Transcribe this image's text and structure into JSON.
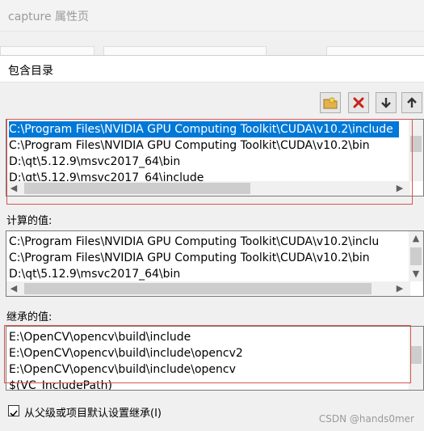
{
  "parent_window": {
    "title": "capture 属性页"
  },
  "dialog": {
    "title": "包含目录"
  },
  "toolbar": {
    "buttons": [
      {
        "icon": "new-folder-icon"
      },
      {
        "icon": "delete-icon"
      },
      {
        "icon": "move-down-icon"
      },
      {
        "icon": "move-up-icon"
      }
    ]
  },
  "include_list": {
    "items": [
      "C:\\Program Files\\NVIDIA GPU Computing Toolkit\\CUDA\\v10.2\\include",
      "C:\\Program Files\\NVIDIA GPU Computing Toolkit\\CUDA\\v10.2\\bin",
      "D:\\qt\\5.12.9\\msvc2017_64\\bin",
      "D:\\qt\\5.12.9\\msvc2017_64\\include"
    ],
    "selected_index": 0
  },
  "computed": {
    "label": "计算的值:",
    "items": [
      "C:\\Program Files\\NVIDIA GPU Computing Toolkit\\CUDA\\v10.2\\inclu",
      "C:\\Program Files\\NVIDIA GPU Computing Toolkit\\CUDA\\v10.2\\bin",
      "D:\\qt\\5.12.9\\msvc2017_64\\bin"
    ]
  },
  "inherited": {
    "label": "继承的值:",
    "items": [
      "E:\\OpenCV\\opencv\\build\\include",
      "E:\\OpenCV\\opencv\\build\\include\\opencv2",
      "E:\\OpenCV\\opencv\\build\\include\\opencv",
      "$(VC_IncludePath)"
    ]
  },
  "inherit_checkbox": {
    "label": "从父级或项目默认设置继承(I)",
    "checked": true
  },
  "watermark": "CSDN @hands0mer",
  "colors": {
    "selection": "#0078d7",
    "highlight_box": "#d9534f"
  }
}
